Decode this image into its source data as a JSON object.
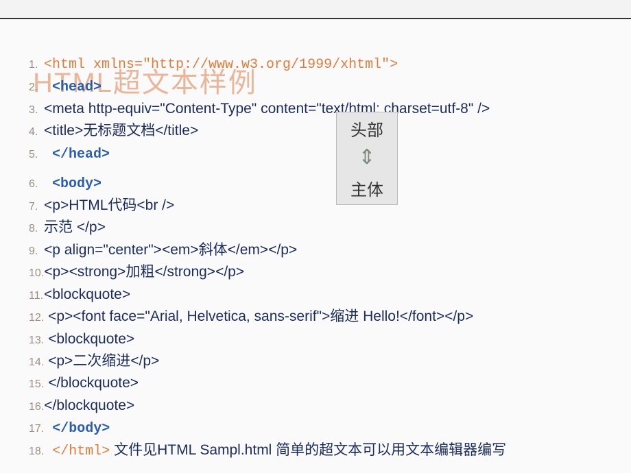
{
  "bg_title": "HTML超文本样例",
  "callout": {
    "top": "头部",
    "arrow": "⇕",
    "bottom": "主体"
  },
  "lines": [
    {
      "num": "1.",
      "parts": [
        {
          "cls": "tag-open",
          "t": "<html xmlns=\"http://www.w3.org/1999/xhtml\">"
        }
      ]
    },
    {
      "num": "2.",
      "parts": [
        {
          "cls": "tag-blue",
          "t": " <head>"
        }
      ]
    },
    {
      "num": "3.",
      "parts": [
        {
          "cls": "tag-navy",
          "t": "<meta http-equiv=\"Content-Type\" content=\"text/html; charset=utf-8\" />"
        }
      ]
    },
    {
      "num": "4.",
      "parts": [
        {
          "cls": "tag-navy",
          "t": "<title>无标题文档</title>"
        }
      ]
    },
    {
      "num": "5.",
      "parts": [
        {
          "cls": "tag-blue",
          "t": " </head>"
        }
      ]
    },
    {
      "spacer": true
    },
    {
      "num": "6.",
      "parts": [
        {
          "cls": "tag-blue",
          "t": " <body>"
        }
      ]
    },
    {
      "num": "7.",
      "parts": [
        {
          "cls": "txt",
          "t": "<p>HTML代码<br />"
        }
      ]
    },
    {
      "num": "8.",
      "parts": [
        {
          "cls": "txt",
          "t": "示范 </p>"
        }
      ]
    },
    {
      "num": "9.",
      "parts": [
        {
          "cls": "txt",
          "t": "<p align=\"center\"><em>斜体</em></p>"
        }
      ]
    },
    {
      "num": "10.",
      "parts": [
        {
          "cls": "txt",
          "t": "<p><strong>加粗</strong></p>"
        }
      ]
    },
    {
      "num": "11.",
      "parts": [
        {
          "cls": "txt",
          "t": "<blockquote>"
        }
      ]
    },
    {
      "num": "12.",
      "parts": [
        {
          "cls": "txt",
          "t": "  <p><font face=\"Arial, Helvetica, sans-serif\">缩进 Hello!</font></p>"
        }
      ]
    },
    {
      "num": "13.",
      "parts": [
        {
          "cls": "txt",
          "t": "  <blockquote>"
        }
      ]
    },
    {
      "num": "14.",
      "parts": [
        {
          "cls": "txt",
          "t": "    <p>二次缩进</p>"
        }
      ]
    },
    {
      "num": "15.",
      "parts": [
        {
          "cls": "txt",
          "t": "  </blockquote>"
        }
      ]
    },
    {
      "num": "16.",
      "parts": [
        {
          "cls": "txt",
          "t": "</blockquote>"
        }
      ]
    },
    {
      "num": "17.",
      "parts": [
        {
          "cls": "tag-blue",
          "t": " </body>"
        }
      ]
    },
    {
      "num": "18.",
      "parts": [
        {
          "cls": "tag-open",
          "t": " </html>"
        },
        {
          "cls": "txt",
          "t": "  文件见HTML Sampl.html   简单的超文本可以用文本编辑器编写"
        }
      ]
    }
  ]
}
